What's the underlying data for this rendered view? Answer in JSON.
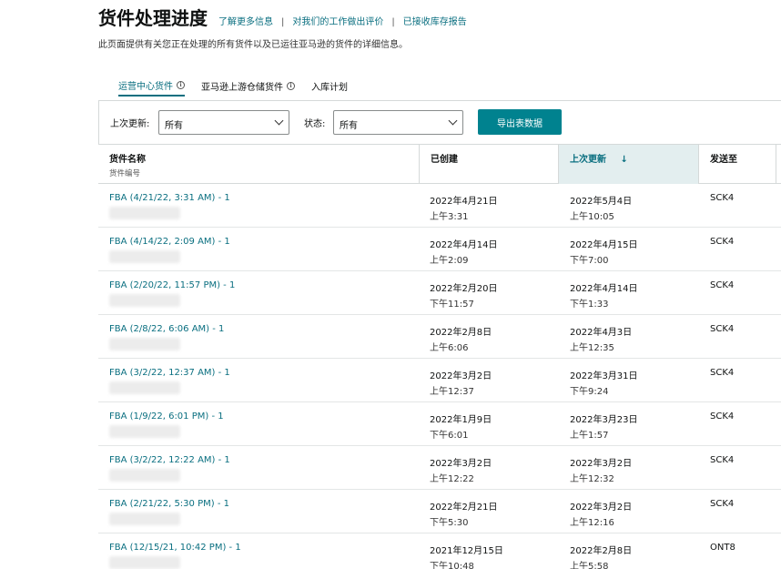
{
  "header": {
    "title": "货件处理进度",
    "links": [
      "了解更多信息",
      "对我们的工作做出评价",
      "已接收库存报告"
    ],
    "separator": "|",
    "description": "此页面提供有关您正在处理的所有货件以及已运往亚马逊的货件的详细信息。"
  },
  "tabs": [
    {
      "label": "运营中心货件",
      "active": true,
      "info": true
    },
    {
      "label": "亚马逊上游仓储货件",
      "active": false,
      "info": true
    },
    {
      "label": "入库计划",
      "active": false,
      "info": false
    }
  ],
  "filters": {
    "last_update_label": "上次更新:",
    "last_update_value": "所有",
    "status_label": "状态:",
    "status_value": "所有",
    "export_label": "导出表数据"
  },
  "table": {
    "columns": {
      "name": "货件名称",
      "name_sub": "货件编号",
      "created": "已创建",
      "updated": "上次更新",
      "ship_to": "发送至"
    },
    "sort_arrow": "↓",
    "rows": [
      {
        "name": "FBA (4/21/22, 3:31 AM) - 1",
        "created_date": "2022年4月21日",
        "created_time": "上午3:31",
        "updated_date": "2022年5月4日",
        "updated_time": "上午10:05",
        "ship_to": "SCK4"
      },
      {
        "name": "FBA (4/14/22, 2:09 AM) - 1",
        "created_date": "2022年4月14日",
        "created_time": "上午2:09",
        "updated_date": "2022年4月15日",
        "updated_time": "下午7:00",
        "ship_to": "SCK4"
      },
      {
        "name": "FBA (2/20/22, 11:57 PM) - 1",
        "created_date": "2022年2月20日",
        "created_time": "下午11:57",
        "updated_date": "2022年4月14日",
        "updated_time": "下午1:33",
        "ship_to": "SCK4"
      },
      {
        "name": "FBA (2/8/22, 6:06 AM) - 1",
        "created_date": "2022年2月8日",
        "created_time": "上午6:06",
        "updated_date": "2022年4月3日",
        "updated_time": "上午12:35",
        "ship_to": "SCK4"
      },
      {
        "name": "FBA (3/2/22, 12:37 AM) - 1",
        "created_date": "2022年3月2日",
        "created_time": "上午12:37",
        "updated_date": "2022年3月31日",
        "updated_time": "下午9:24",
        "ship_to": "SCK4"
      },
      {
        "name": "FBA (1/9/22, 6:01 PM) - 1",
        "created_date": "2022年1月9日",
        "created_time": "下午6:01",
        "updated_date": "2022年3月23日",
        "updated_time": "上午1:57",
        "ship_to": "SCK4"
      },
      {
        "name": "FBA (3/2/22, 12:22 AM) - 1",
        "created_date": "2022年3月2日",
        "created_time": "上午12:22",
        "updated_date": "2022年3月2日",
        "updated_time": "上午12:32",
        "ship_to": "SCK4"
      },
      {
        "name": "FBA (2/21/22, 5:30 PM) - 1",
        "created_date": "2022年2月21日",
        "created_time": "下午5:30",
        "updated_date": "2022年3月2日",
        "updated_time": "上午12:16",
        "ship_to": "SCK4"
      },
      {
        "name": "FBA (12/15/21, 10:42 PM) - 1",
        "created_date": "2021年12月15日",
        "created_time": "下午10:48",
        "updated_date": "2022年2月8日",
        "updated_time": "上午5:58",
        "ship_to": "ONT8"
      }
    ]
  },
  "colors": {
    "link": "#0a6f80",
    "button": "#00828f",
    "sorted_header_bg": "#e3eeef"
  }
}
